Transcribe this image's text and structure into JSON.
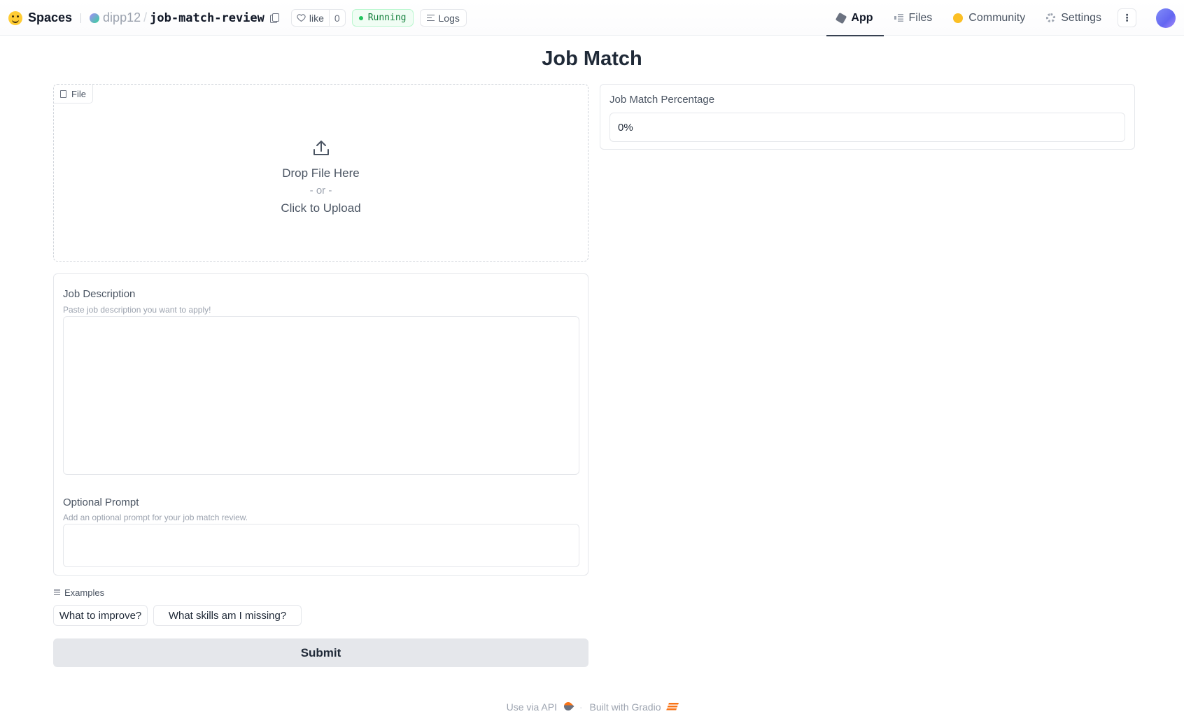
{
  "header": {
    "brand": "Spaces",
    "owner": "dipp12",
    "separator": "/",
    "repo": "job-match-review",
    "like_label": "like",
    "like_count": "0",
    "status": "Running",
    "logs_label": "Logs",
    "tabs": [
      {
        "label": "App",
        "icon": "cube-icon",
        "active": true
      },
      {
        "label": "Files",
        "icon": "files-icon",
        "active": false
      },
      {
        "label": "Community",
        "icon": "community-icon",
        "active": false
      },
      {
        "label": "Settings",
        "icon": "gear-icon",
        "active": false
      }
    ],
    "more_label": "⋮"
  },
  "main": {
    "title": "Job Match",
    "upload": {
      "label": "File",
      "drop_text": "Drop File Here",
      "or_text": "- or -",
      "click_text": "Click to Upload"
    },
    "job_description": {
      "label": "Job Description",
      "info": "Paste job description you want to apply!",
      "value": ""
    },
    "optional_prompt": {
      "label": "Optional Prompt",
      "info": "Add an optional prompt for your job match review.",
      "value": ""
    },
    "examples": {
      "label": "Examples",
      "items": [
        "What to improve?",
        "What skills am I missing?"
      ]
    },
    "submit_label": "Submit",
    "output": {
      "label": "Job Match Percentage",
      "value": "0%"
    }
  },
  "footer": {
    "api_label": "Use via API",
    "separator": "·",
    "built_label": "Built with Gradio"
  },
  "colors": {
    "running_bg": "#f0fdf4",
    "running_text": "#15803d",
    "submit_bg": "#e5e7eb",
    "accent_orange": "#f97316"
  }
}
